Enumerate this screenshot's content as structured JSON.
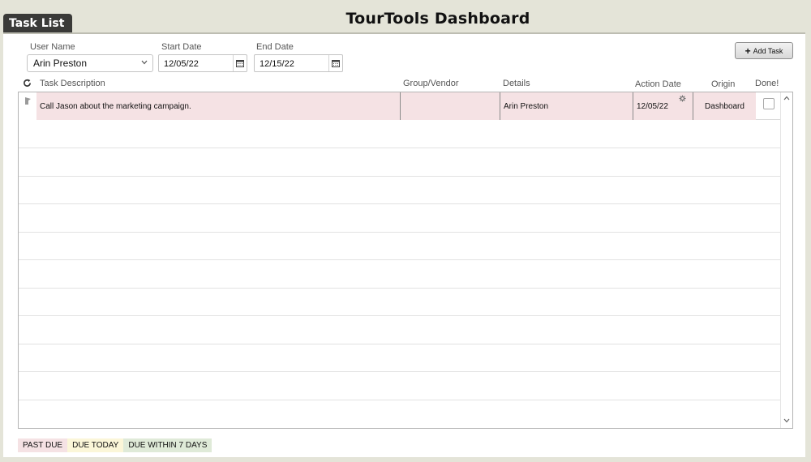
{
  "app": {
    "title": "TourTools Dashboard"
  },
  "tab": {
    "label": "Task List"
  },
  "filters": {
    "user_label": "User Name",
    "user_value": "Arin Preston",
    "start_label": "Start Date",
    "start_value": "12/05/22",
    "end_label": "End Date",
    "end_value": "12/15/22"
  },
  "toolbar": {
    "add_task_label": "Add Task"
  },
  "columns": {
    "task_description": "Task Description",
    "group_vendor": "Group/Vendor",
    "details": "Details",
    "action_date": "Action Date",
    "origin": "Origin",
    "done": "Done!"
  },
  "tasks": [
    {
      "description": "Call Jason about the marketing campaign.",
      "group_vendor": "",
      "details": "Arin Preston",
      "action_date": "12/05/22",
      "origin": "Dashboard",
      "done": false,
      "status": "past_due"
    }
  ],
  "legend": {
    "past_due": "PAST DUE",
    "due_today": "DUE TODAY",
    "due_within_7": "DUE WITHIN 7 DAYS"
  },
  "colors": {
    "past_due": "#f5e2e4",
    "due_today": "#fbf6d8",
    "due_within_7": "#dfead8",
    "tab_bg": "#3a3a38",
    "page_bg": "#e4e4d8"
  },
  "icons": {
    "refresh": "refresh-icon",
    "calendar": "calendar-icon",
    "plus": "plus-icon",
    "chevron": "chevron-down-icon",
    "flag": "flag-icon",
    "gear": "gear-icon"
  }
}
